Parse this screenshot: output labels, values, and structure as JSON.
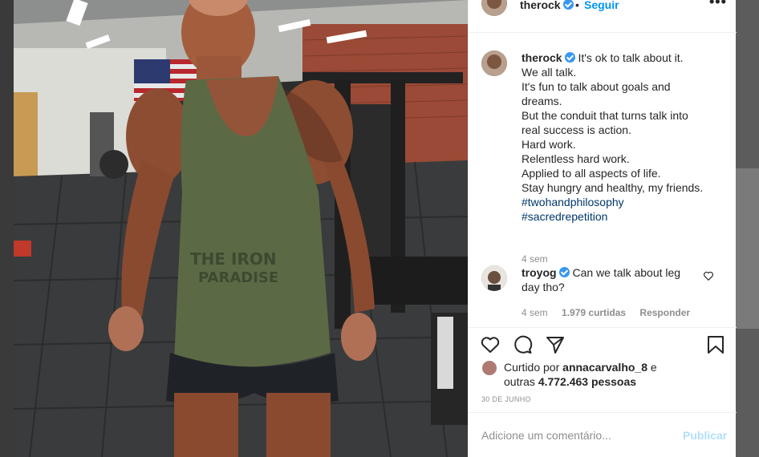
{
  "post": {
    "username": "therock",
    "separator": "•",
    "follow_label": "Seguir",
    "more_label": "•••"
  },
  "caption": {
    "username": "therock",
    "lines": [
      "It's ok to talk about it.",
      "We all talk.",
      "It's fun to talk about goals and",
      "dreams.",
      "But the conduit that turns talk into",
      "real success is action.",
      "Hard work.",
      "Relentless hard work.",
      "Applied to all aspects of life.",
      "Stay hungry and healthy, my friends."
    ],
    "hashtags": [
      "#twohandphilosophy",
      "#sacredrepetition"
    ],
    "time": "4 sem"
  },
  "comment": {
    "username": "troyog",
    "lines": [
      "Can we talk about leg",
      "day tho?"
    ],
    "time": "4 sem",
    "likes": "1.979 curtidas",
    "reply_label": "Responder"
  },
  "likes": {
    "prefix": "Curtido por",
    "user": "annacarvalho_8",
    "mid": "e",
    "line2_prefix": "outras",
    "count": "4.772.463 pessoas"
  },
  "date": "30 DE JUNHO",
  "add_comment": {
    "placeholder": "Adicione um comentário...",
    "publish_label": "Publicar"
  },
  "icons": {
    "like": "heart-icon",
    "comment": "comment-icon",
    "share": "share-icon",
    "save": "bookmark-icon",
    "verified": "verified-badge-icon"
  },
  "colors": {
    "link_blue": "#0095f6",
    "hashtag": "#00376b",
    "verified": "#3897f0",
    "muted": "#8e8e8e",
    "publish_disabled": "#b2dffc"
  }
}
